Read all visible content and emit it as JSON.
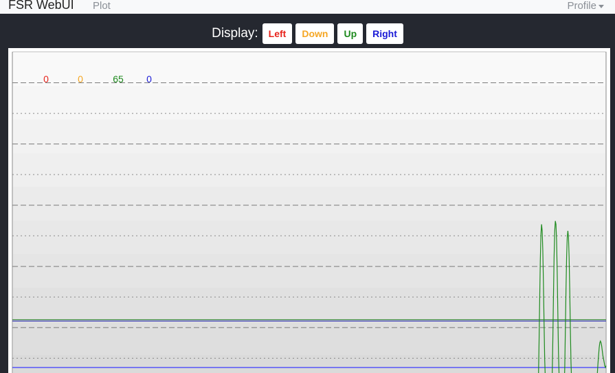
{
  "navbar": {
    "brand": "FSR WebUI",
    "plot_link": "Plot",
    "profile_menu": "Profile"
  },
  "display": {
    "label": "Display:",
    "buttons": [
      {
        "label": "Left",
        "color": "#e8231b"
      },
      {
        "label": "Down",
        "color": "#f5a623"
      },
      {
        "label": "Up",
        "color": "#1e8a1e"
      },
      {
        "label": "Right",
        "color": "#1a1ad6"
      }
    ]
  },
  "readouts": [
    {
      "value": "0",
      "color": "#e8231b"
    },
    {
      "value": "0",
      "color": "#f5a623"
    },
    {
      "value": "65",
      "color": "#1e8a1e"
    },
    {
      "value": "0",
      "color": "#1a1ad6"
    }
  ],
  "chart_data": {
    "type": "line",
    "ylim": [
      0,
      1023
    ],
    "grid": true,
    "thresholds": [
      {
        "series": "Up",
        "value": 210,
        "color": "#3a8a3a"
      },
      {
        "series": "Right",
        "value": 206,
        "color": "#2b2bb0"
      }
    ],
    "series": [
      {
        "name": "Up",
        "color": "#1e8a1e",
        "values": [
          0,
          0,
          0,
          0,
          0,
          0,
          0,
          0,
          0,
          0,
          0,
          0,
          0,
          0,
          0,
          0,
          0,
          0,
          0,
          0,
          0,
          0,
          0,
          0,
          0,
          0,
          0,
          0,
          0,
          0,
          0,
          0,
          0,
          0,
          0,
          0,
          0,
          0,
          0,
          0,
          0,
          0,
          0,
          0,
          0,
          0,
          0,
          0,
          0,
          0,
          0,
          0,
          0,
          0,
          0,
          0,
          0,
          0,
          0,
          0,
          0,
          0,
          0,
          0,
          0,
          0,
          0,
          0,
          0,
          0,
          0,
          0,
          0,
          0,
          0,
          0,
          0,
          0,
          0,
          0,
          0,
          0,
          0,
          0,
          0,
          0,
          0,
          0,
          0,
          0,
          0,
          0,
          0,
          0,
          0,
          0,
          0,
          0,
          0,
          0,
          0,
          0,
          0,
          0,
          0,
          0,
          0,
          0,
          0,
          0,
          0,
          0,
          0,
          0,
          0,
          0,
          0,
          0,
          0,
          0,
          0,
          0,
          0,
          0,
          0,
          0,
          0,
          0,
          0,
          0,
          0,
          0,
          0,
          0,
          0,
          0,
          0,
          0,
          0,
          0,
          0,
          0,
          0,
          0,
          0,
          0,
          0,
          0,
          0,
          0,
          0,
          0,
          0,
          0,
          0,
          0,
          0,
          0,
          0,
          0,
          0,
          0,
          0,
          0,
          0,
          0,
          0,
          0,
          0,
          0,
          0,
          0,
          0,
          0,
          0,
          0,
          0,
          0,
          0,
          0,
          0,
          0,
          0,
          0,
          0,
          0,
          0,
          0,
          0,
          0,
          0,
          0,
          0,
          0,
          0,
          0,
          0,
          0,
          0,
          0,
          0,
          0,
          0,
          0,
          0,
          0,
          0,
          0,
          0,
          0,
          0,
          0,
          0,
          0,
          0,
          0,
          0,
          0,
          0,
          0,
          0,
          0,
          0,
          0,
          0,
          0,
          0,
          0,
          0,
          0,
          0,
          0,
          0,
          0,
          0,
          0,
          0,
          0,
          0,
          0,
          0,
          0,
          0,
          0,
          0,
          0,
          0,
          0,
          0,
          0,
          0,
          0,
          0,
          0,
          0,
          0,
          0,
          0,
          0,
          0,
          0,
          0,
          0,
          0,
          0,
          0,
          0,
          0,
          0,
          0,
          0,
          0,
          0,
          0,
          0,
          0,
          0,
          0,
          0,
          0,
          0,
          0,
          0,
          0,
          0,
          0,
          0,
          0,
          0,
          0,
          0,
          0,
          0,
          0,
          0,
          0,
          0,
          0,
          0,
          0,
          0,
          0,
          0,
          0,
          0,
          0,
          0,
          0,
          0,
          0,
          0,
          0,
          0,
          0,
          0,
          0,
          0,
          0,
          0,
          0,
          0,
          0,
          0,
          0,
          0,
          0,
          0,
          0,
          0,
          0,
          0,
          0,
          0,
          0,
          0,
          0,
          0,
          0,
          0,
          0,
          0,
          0,
          0,
          0,
          0,
          0,
          0,
          0,
          0,
          0,
          0,
          0,
          0,
          0,
          0,
          0,
          0,
          0,
          0,
          0,
          0,
          0,
          0,
          0,
          0,
          0,
          0,
          0,
          0,
          0,
          0,
          0,
          0,
          0,
          0,
          0,
          0,
          0,
          0,
          0,
          0,
          0,
          0,
          0,
          0,
          0,
          0,
          0,
          0,
          0,
          0,
          0,
          0,
          0,
          0,
          0,
          0,
          0,
          0,
          0,
          0,
          0,
          0,
          0,
          0,
          0,
          0,
          0,
          0,
          0,
          0,
          0,
          0,
          0,
          0,
          0,
          0,
          0,
          0,
          0,
          0,
          0,
          0,
          0,
          0,
          0,
          0,
          0,
          0,
          0,
          0,
          0,
          0,
          0,
          0,
          0,
          0,
          0,
          0,
          0,
          0,
          0,
          0,
          0,
          0,
          0,
          0,
          0,
          0,
          0,
          0,
          0,
          0,
          0,
          0,
          0,
          0,
          0,
          0,
          0,
          0,
          0,
          0,
          0,
          0,
          0,
          0,
          0,
          0,
          0,
          0,
          0,
          0,
          0,
          0,
          0,
          0,
          0,
          0,
          0,
          0,
          0,
          0,
          0,
          0,
          0,
          0,
          0,
          0,
          0,
          0,
          0,
          0,
          0,
          0,
          0,
          0,
          0,
          0,
          0,
          0,
          0,
          0,
          0,
          0,
          0,
          0,
          0,
          0,
          0,
          0,
          0,
          0,
          0,
          0,
          0,
          0,
          0,
          0,
          0,
          0,
          0,
          0,
          0,
          0,
          0,
          0,
          0,
          0,
          0,
          0,
          0,
          0,
          0,
          0,
          0,
          0,
          0,
          0,
          0,
          0,
          0,
          0,
          0,
          0,
          0,
          0,
          0,
          0,
          0,
          0,
          0,
          0,
          0,
          0,
          0,
          0,
          0,
          0,
          0,
          0,
          0,
          0,
          0,
          0,
          0,
          0,
          0,
          0,
          0,
          0,
          0,
          0,
          0,
          0,
          0,
          0,
          0,
          0,
          0,
          0,
          0,
          0,
          0,
          0,
          0,
          0,
          0,
          0,
          0,
          0,
          0,
          0,
          0,
          0,
          0,
          0,
          0,
          0,
          0,
          0,
          0,
          0,
          0,
          0,
          0,
          0,
          0,
          0,
          0,
          0,
          0,
          0,
          0,
          0,
          0,
          0,
          0,
          0,
          0,
          0,
          0,
          0,
          0,
          0,
          0,
          0,
          0,
          0,
          0,
          0,
          0,
          0,
          0,
          0,
          0,
          0,
          0,
          0,
          0,
          0,
          0,
          0,
          0,
          0,
          0,
          0,
          0,
          0,
          0,
          0,
          0,
          0,
          0,
          0,
          0,
          0,
          0,
          0,
          0,
          0,
          0,
          0,
          0,
          0,
          0,
          0,
          0,
          0,
          0,
          0,
          0,
          0,
          0,
          0,
          0,
          0,
          0,
          0,
          0,
          0,
          0,
          0,
          0,
          0,
          0,
          0,
          0,
          0,
          0,
          0,
          0,
          0,
          0,
          0,
          0,
          0,
          0,
          0,
          0,
          0,
          0,
          0,
          0,
          0,
          0,
          0,
          0,
          0,
          0,
          0,
          0,
          0,
          0,
          0,
          0,
          0,
          0,
          0,
          0,
          0,
          0,
          0,
          0,
          0,
          0,
          0,
          0,
          0,
          0,
          0,
          0,
          0,
          0,
          0,
          0,
          0,
          0,
          0,
          0,
          0,
          0,
          0,
          0,
          0,
          0,
          0,
          0,
          0,
          0,
          0,
          0,
          0,
          0,
          0,
          0,
          0,
          0,
          0,
          0,
          0,
          0,
          0,
          0,
          0,
          0,
          0,
          0,
          0,
          0,
          0,
          0,
          0,
          0,
          0,
          0,
          0,
          0,
          0,
          0,
          0,
          0,
          0,
          0,
          0,
          0,
          0,
          0,
          0,
          0,
          0,
          0,
          0,
          0,
          0,
          0,
          0,
          0,
          0,
          0,
          0,
          0,
          0,
          0,
          0,
          0,
          0,
          0,
          0,
          0,
          0,
          0,
          0,
          0,
          0,
          0,
          0,
          0,
          0,
          0,
          0,
          0,
          0,
          0,
          0,
          0,
          0,
          0,
          0,
          0,
          0,
          0,
          0,
          0,
          0,
          0,
          0,
          0,
          0,
          0,
          30,
          140,
          270,
          390,
          470,
          500,
          480,
          420,
          320,
          200,
          90,
          30,
          10,
          5,
          5,
          5,
          5,
          5,
          5,
          5,
          5,
          10,
          40,
          150,
          280,
          400,
          480,
          510,
          500,
          450,
          350,
          230,
          110,
          40,
          10,
          5,
          5,
          5,
          5,
          5,
          5,
          10,
          60,
          180,
          300,
          400,
          460,
          480,
          460,
          400,
          300,
          180,
          80,
          20,
          5,
          0,
          0,
          0,
          0,
          0,
          0,
          0,
          0,
          0,
          0,
          0,
          0,
          0,
          0,
          0,
          0,
          0,
          0,
          0,
          0,
          0,
          0,
          0,
          0,
          0,
          0,
          0,
          0,
          0,
          0,
          0,
          0,
          0,
          0,
          0,
          0,
          0,
          5,
          20,
          45,
          75,
          100,
          125,
          140,
          145,
          140,
          130,
          115,
          100,
          90,
          80,
          70,
          65,
          70
        ]
      }
    ]
  }
}
